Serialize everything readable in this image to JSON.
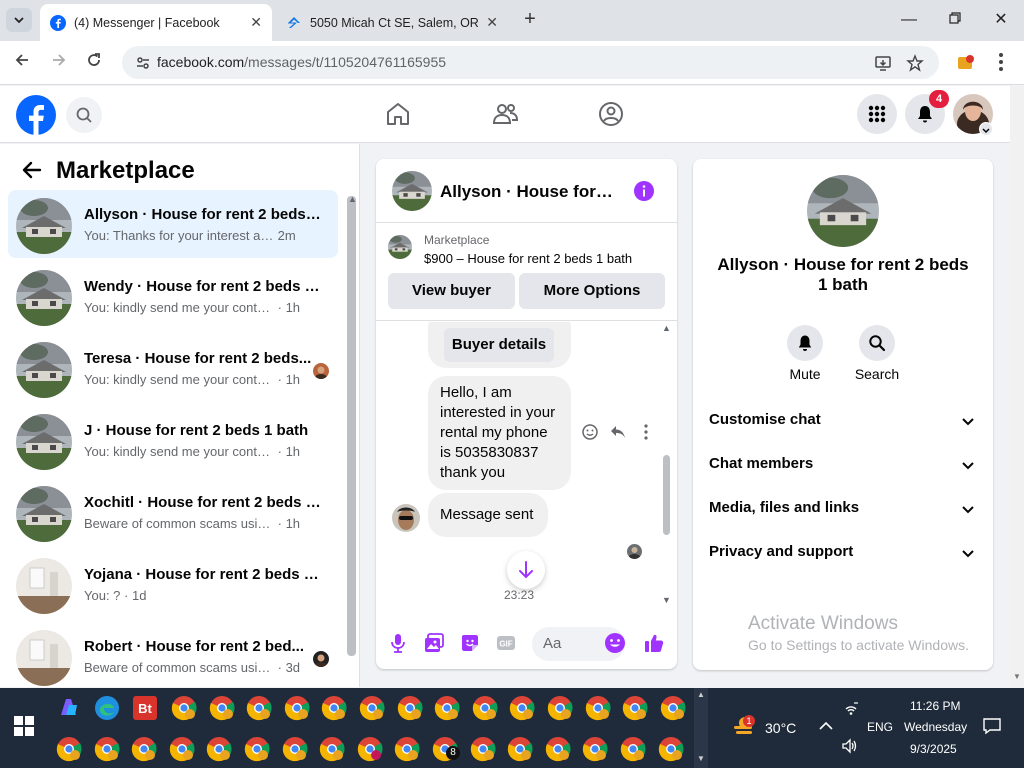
{
  "browser": {
    "tabs": [
      {
        "title": "(4) Messenger | Facebook",
        "active": true
      },
      {
        "title": "5050 Micah Ct SE, Salem, OR 97",
        "active": false
      }
    ],
    "url_host": "facebook.com",
    "url_path": "/messages/t/1105204761165955"
  },
  "fb": {
    "notification_count": "4"
  },
  "sidebar": {
    "title": "Marketplace",
    "conversations": [
      {
        "name": "Allyson · House for rent 2 beds 1...",
        "preview": "You: Thanks for your interest and i...",
        "time": "2m",
        "active": true,
        "seen_avatar": false,
        "thumb": "house"
      },
      {
        "name": "Wendy · House for rent 2 beds 1...",
        "preview": "You: kindly send me your contact n...",
        "time": "· 1h",
        "active": false,
        "seen_avatar": false,
        "thumb": "house"
      },
      {
        "name": "Teresa · House for rent 2 beds...",
        "preview": "You: kindly send me your contac...",
        "time": "· 1h",
        "active": false,
        "seen_avatar": true,
        "thumb": "house"
      },
      {
        "name": "J · House for rent 2 beds 1 bath",
        "preview": "You: kindly send me your contact n...",
        "time": "· 1h",
        "active": false,
        "seen_avatar": false,
        "thumb": "house"
      },
      {
        "name": "Xochitl · House for rent 2 beds 1...",
        "preview": "Beware of common scams using pa...",
        "time": "· 1h",
        "active": false,
        "seen_avatar": false,
        "thumb": "house"
      },
      {
        "name": "Yojana · House for rent 2 beds 1 ...",
        "preview": "You: ?",
        "time": "· 1d",
        "active": false,
        "seen_avatar": false,
        "thumb": "room"
      },
      {
        "name": "Robert · House for rent 2 bed...",
        "preview": "Beware of common scams using...",
        "time": "· 3d",
        "active": false,
        "seen_avatar": true,
        "thumb": "room"
      }
    ]
  },
  "chat": {
    "title": "Allyson · House for r...",
    "listing_label": "Marketplace",
    "listing_price": "$900 – House for rent 2 beds 1 bath",
    "view_buyer": "View buyer",
    "more_options": "More Options",
    "buyer_details": "Buyer details",
    "message_1": "Hello, I am interested in your rental my phone is 5035830837 thank you",
    "message_2": "Message sent",
    "timestamp": "23:23",
    "composer_placeholder": "Aa"
  },
  "details": {
    "name": "Allyson · House for rent 2 beds 1 bath",
    "actions": [
      {
        "label": "Mute",
        "icon": "bell-icon"
      },
      {
        "label": "Search",
        "icon": "search-icon"
      }
    ],
    "sections": [
      "Customise chat",
      "Chat members",
      "Media, files and links",
      "Privacy and support"
    ]
  },
  "watermark": {
    "line1": "Activate Windows",
    "line2": "Go to Settings to activate Windows."
  },
  "taskbar": {
    "weather_temp": "30°C",
    "weather_badge": "1",
    "language": "ENG",
    "time": "11:26 PM",
    "day": "Wednesday",
    "date": "9/3/2025",
    "whatsapp_badge": "8"
  },
  "colors": {
    "fb_blue": "#0866ff",
    "messenger_purple": "#a033ff",
    "active_row": "#e7f3ff",
    "notif_red": "#e41e3f",
    "taskbar": "#1f2b3a"
  }
}
